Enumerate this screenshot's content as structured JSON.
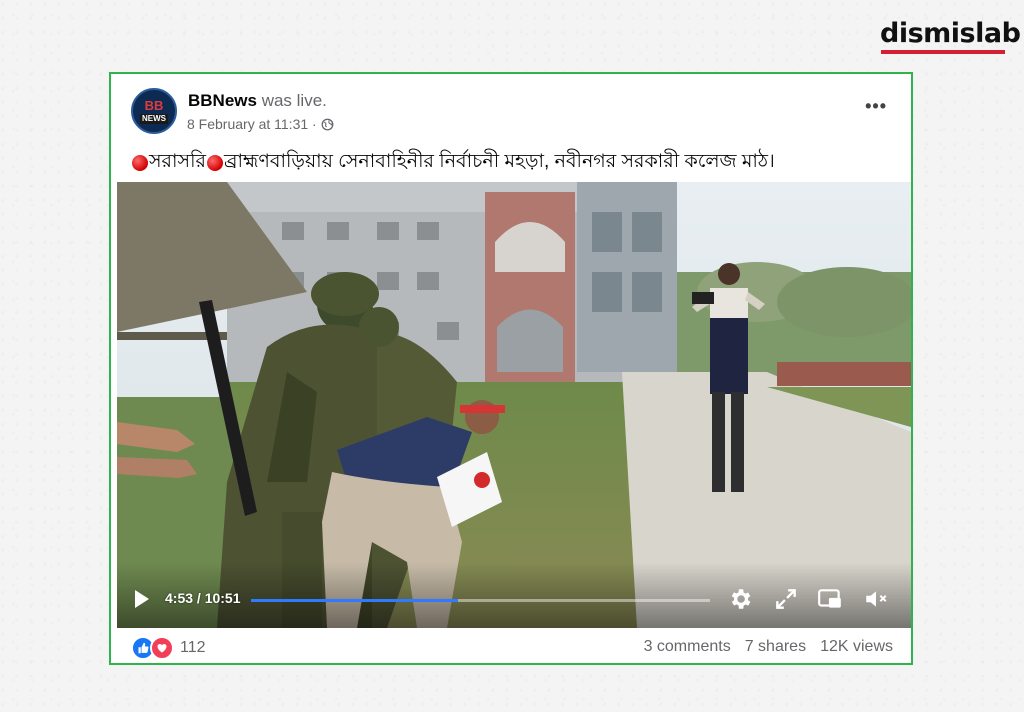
{
  "brand": {
    "name": "dismislab",
    "accent": "#d32034"
  },
  "post": {
    "page_name": "BBNews",
    "status": "was live.",
    "timestamp": "8 February at 11:31 ·",
    "privacy_icon": "globe-icon",
    "avatar_logo": {
      "top": "BB",
      "bottom": "NEWS"
    },
    "caption_part1": "সরাসরি",
    "caption_part2": " ব্রাহ্মণবাড়িয়ায় সেনাবাহিনীর নির্বাচনী মহড়া, নবীনগর সরকারী কলেজ মাঠ।",
    "more_label": "•••"
  },
  "video": {
    "time_display": "4:53 / 10:51",
    "progress": 0.45,
    "progress_color": "#2f7bff",
    "icons": [
      "play-icon",
      "settings-icon",
      "fullscreen-icon",
      "miniplayer-icon",
      "mute-icon"
    ]
  },
  "engagement": {
    "reaction_icons": [
      "like-icon",
      "love-icon"
    ],
    "reactions_count": "112",
    "comments": "3 comments",
    "shares": "7 shares",
    "views": "12K views"
  },
  "colors": {
    "card_border": "#2fb34a",
    "secondary_text": "#65676b"
  }
}
